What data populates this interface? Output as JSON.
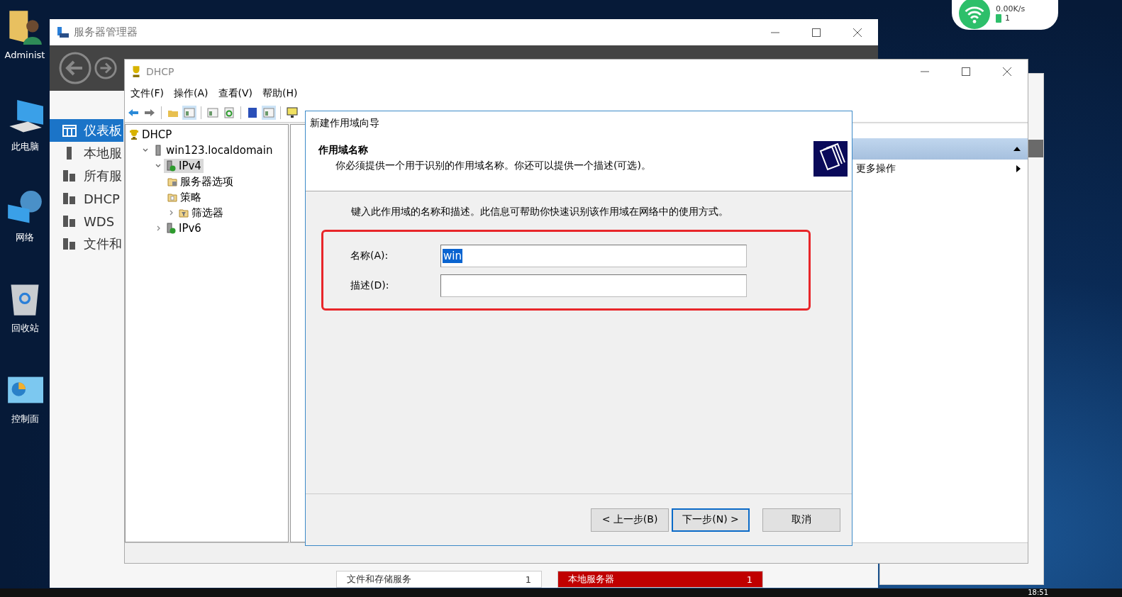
{
  "desktop": {
    "icons": [
      {
        "kind": "user",
        "label": "Administ"
      },
      {
        "kind": "computer",
        "label": "此电脑"
      },
      {
        "kind": "network",
        "label": "网络"
      },
      {
        "kind": "recycle",
        "label": "回收站"
      },
      {
        "kind": "control",
        "label": "控制面"
      }
    ]
  },
  "network_widget": {
    "speed": "0.00K/s",
    "devices": "1"
  },
  "server_manager": {
    "title": "服务器管理器",
    "sidebar": [
      {
        "kind": "dashboard",
        "label": "仪表板",
        "selected": true
      },
      {
        "kind": "server",
        "label": "本地服",
        "selected": false
      },
      {
        "kind": "servers",
        "label": "所有服",
        "selected": false
      },
      {
        "kind": "dhcp",
        "label": "DHCP",
        "selected": false
      },
      {
        "kind": "wds",
        "label": "WDS",
        "selected": false
      },
      {
        "kind": "files",
        "label": "文件和",
        "selected": false
      }
    ],
    "tiles": [
      {
        "title": "文件和存储服务",
        "count": "1",
        "alert": false
      },
      {
        "title": "本地服务器",
        "count": "1",
        "alert": true
      }
    ]
  },
  "dhcp": {
    "title": "DHCP",
    "menu": [
      "文件(F)",
      "操作(A)",
      "查看(V)",
      "帮助(H)"
    ],
    "toolbar": [
      {
        "kind": "back",
        "pressed": false
      },
      {
        "kind": "forward",
        "pressed": false
      },
      {
        "kind": "up",
        "pressed": false
      },
      {
        "kind": "tree",
        "pressed": true
      },
      {
        "kind": "properties",
        "pressed": false
      },
      {
        "kind": "refresh",
        "pressed": false
      },
      {
        "kind": "help",
        "pressed": false
      },
      {
        "kind": "actions",
        "pressed": true
      },
      {
        "kind": "monitor",
        "pressed": false
      }
    ],
    "tree": [
      {
        "kind": "root",
        "label": "DHCP",
        "selected": false,
        "children": [
          {
            "kind": "server",
            "label": "win123.localdomain",
            "selected": false,
            "expanded": true,
            "children": [
              {
                "kind": "protocol",
                "label": "IPv4",
                "selected": true,
                "expanded": true,
                "children": [
                  {
                    "kind": "options",
                    "label": "服务器选项",
                    "selected": false
                  },
                  {
                    "kind": "policy",
                    "label": "策略",
                    "selected": false
                  },
                  {
                    "kind": "filter",
                    "label": "筛选器",
                    "selected": false,
                    "expanded": false
                  }
                ]
              },
              {
                "kind": "protocol",
                "label": "IPv6",
                "selected": false,
                "expanded": false
              }
            ]
          }
        ]
      }
    ],
    "actions": [
      {
        "label": "更多操作"
      }
    ]
  },
  "wizard": {
    "title": "新建作用域向导",
    "heading": "作用域名称",
    "subheading": "你必须提供一个用于识别的作用域名称。你还可以提供一个描述(可选)。",
    "instruction": "键入此作用域的名称和描述。此信息可帮助你快速识别该作用域在网络中的使用方式。",
    "fields": [
      {
        "label": "名称(A):",
        "value": "win",
        "text_selected": true
      },
      {
        "label": "描述(D):"
      }
    ],
    "buttons": [
      {
        "label": "< 上一步(B)",
        "focused": false
      },
      {
        "label": "下一步(N) >",
        "focused": true
      },
      {
        "label": "取消",
        "focused": false
      }
    ]
  },
  "taskbar": {
    "time": "18:51"
  }
}
